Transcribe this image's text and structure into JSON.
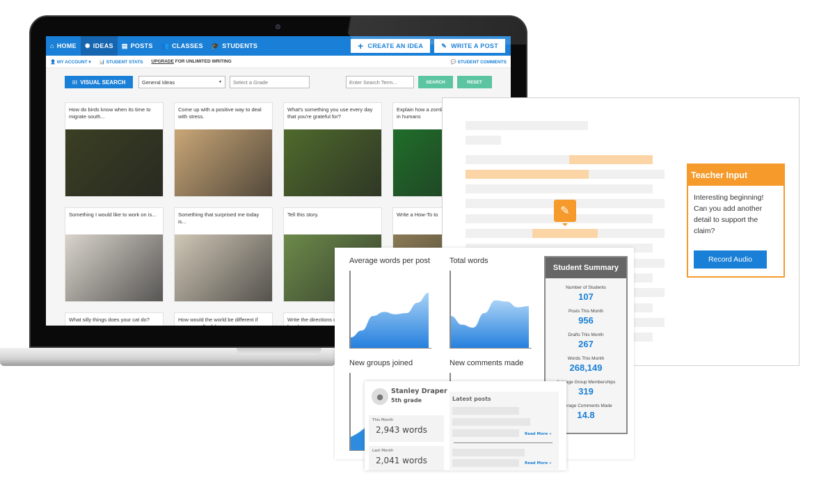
{
  "nav": {
    "items": [
      {
        "icon": "home-icon",
        "label": "HOME"
      },
      {
        "icon": "lightbulb-icon",
        "label": "IDEAS",
        "active": true
      },
      {
        "icon": "posts-icon",
        "label": "POSTS"
      },
      {
        "icon": "classes-icon",
        "label": "CLASSES"
      },
      {
        "icon": "graduation-cap-icon",
        "label": "STUDENTS"
      }
    ],
    "create_idea": "CREATE AN IDEA",
    "write_post": "WRITE A POST"
  },
  "subnav": {
    "account": "MY ACCOUNT ▾",
    "stats": "STUDENT STATS",
    "upgrade": "UPGRADE",
    "upgrade_suffix": "FOR UNLIMITED WRITING",
    "comments": "STUDENT COMMENTS"
  },
  "toolbar": {
    "visual_search": "VISUAL SEARCH",
    "category": "General Ideas",
    "grade_placeholder": "Select a Grade",
    "search_placeholder": "Enter Search Term...",
    "search": "SEARCH",
    "reset": "RESET"
  },
  "ideas": [
    {
      "text": "How do birds know when its time to migrate south...",
      "color": "#3b3f22"
    },
    {
      "text": "Come up with a positive way to deal with stress.",
      "color": "#c9a677"
    },
    {
      "text": "What's something you use every day that you're grateful for?",
      "color": "#4f6a2c"
    },
    {
      "text": "Explain how a zombie would manifest in humans",
      "color": "#1f6e2a"
    },
    {
      "text": "Something I would like to work on is...",
      "color": "#d9d4cc"
    },
    {
      "text": "Something that surprised me today is...",
      "color": "#cfc6b5"
    },
    {
      "text": "Tell this story.",
      "color": "#6c8a4a"
    },
    {
      "text": "Write a How-To to",
      "color": "#8a7a55"
    },
    {
      "text": "What silly things does your cat do?",
      "color": "#fff"
    },
    {
      "text": "How would the world be different if money really did...",
      "color": "#fff"
    },
    {
      "text": "Write the directions ultimate hamburger.",
      "color": "#fff"
    }
  ],
  "teacher": {
    "title": "Teacher Input",
    "body": "Interesting beginning! Can you add another detail to support the claim?",
    "button": "Record Audio"
  },
  "charts": [
    {
      "title": "Average words per post",
      "series": [
        0.18,
        0.3,
        0.55,
        0.62,
        0.58,
        0.6,
        0.78,
        0.95
      ]
    },
    {
      "title": "Total words",
      "series": [
        0.55,
        0.4,
        0.35,
        0.6,
        0.82,
        0.8,
        0.7,
        0.72
      ]
    },
    {
      "title": "New groups joined"
    },
    {
      "title": "New comments made"
    }
  ],
  "summary": {
    "title": "Student Summary",
    "stats": [
      {
        "label": "Number of Students",
        "value": "107"
      },
      {
        "label": "Posts This Month",
        "value": "956"
      },
      {
        "label": "Drafts This Month",
        "value": "267"
      },
      {
        "label": "Words This Month",
        "value": "268,149"
      },
      {
        "label": "Average Group Memberships",
        "value": "319"
      },
      {
        "label": "Average Comments Made",
        "value": "14.8"
      }
    ]
  },
  "student": {
    "name": "Stanley Draper",
    "grade": "5th grade",
    "this_month_label": "This Month",
    "this_month": "2,943 words",
    "last_month_label": "Last Month",
    "last_month": "2,041 words",
    "latest_label": "Latest posts",
    "read_more": "Read More »"
  }
}
